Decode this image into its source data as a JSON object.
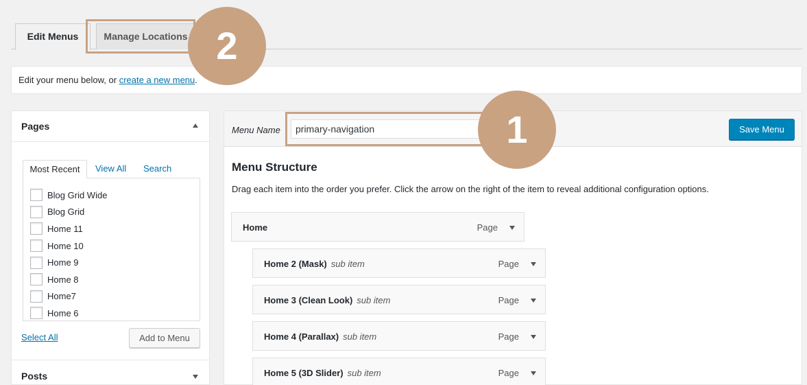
{
  "tabs": {
    "edit_menus": "Edit Menus",
    "manage_locations": "Manage Locations"
  },
  "notice": {
    "prefix": "Edit your menu below, or ",
    "link": "create a new menu",
    "suffix": "."
  },
  "pages_panel": {
    "title": "Pages",
    "tabs": [
      "Most Recent",
      "View All",
      "Search"
    ],
    "items": [
      "Blog Grid Wide",
      "Blog Grid",
      "Home 11",
      "Home 10",
      "Home 9",
      "Home 8",
      "Home7",
      "Home 6"
    ],
    "select_all": "Select All",
    "add_button": "Add to Menu"
  },
  "posts_panel": {
    "title": "Posts"
  },
  "menu_editor": {
    "name_label": "Menu Name",
    "name_value": "primary-navigation",
    "save_button": "Save Menu",
    "structure_title": "Menu Structure",
    "structure_desc": "Drag each item into the order you prefer. Click the arrow on the right of the item to reveal additional configuration options.",
    "items": [
      {
        "title": "Home",
        "sub": "",
        "type": "Page"
      },
      {
        "title": "Home 2 (Mask)",
        "sub": "sub item",
        "type": "Page"
      },
      {
        "title": "Home 3 (Clean Look)",
        "sub": "sub item",
        "type": "Page"
      },
      {
        "title": "Home 4 (Parallax)",
        "sub": "sub item",
        "type": "Page"
      },
      {
        "title": "Home 5 (3D Slider)",
        "sub": "sub item",
        "type": "Page"
      }
    ]
  },
  "badges": {
    "one": "1",
    "two": "2"
  },
  "colors": {
    "accent": "#0085ba",
    "link": "#0073aa",
    "badge": "#c9a282"
  }
}
